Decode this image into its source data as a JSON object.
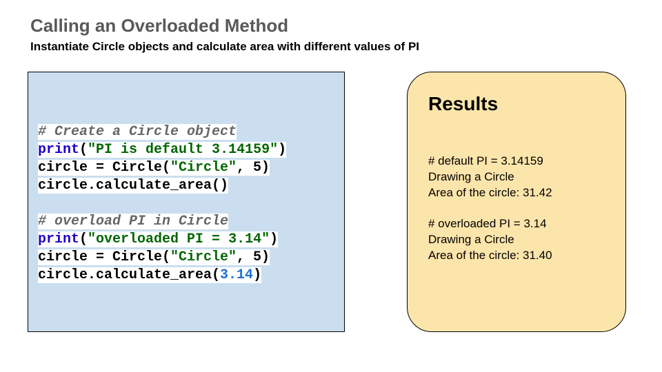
{
  "header": {
    "title": "Calling an Overloaded Method",
    "subtitle": "Instantiate Circle objects and calculate area with different values of PI"
  },
  "code": {
    "lines": [
      {
        "type": "code",
        "tokens": [
          {
            "cls": "comment",
            "text": "# Create a Circle object"
          }
        ]
      },
      {
        "type": "code",
        "tokens": [
          {
            "cls": "keyword",
            "text": "print"
          },
          {
            "cls": "plain",
            "text": "("
          },
          {
            "cls": "string",
            "text": "\"PI is default 3.14159\""
          },
          {
            "cls": "plain",
            "text": ")"
          }
        ]
      },
      {
        "type": "code",
        "tokens": [
          {
            "cls": "plain",
            "text": "circle = Circle("
          },
          {
            "cls": "string",
            "text": "\"Circle\""
          },
          {
            "cls": "plain",
            "text": ", 5)"
          }
        ]
      },
      {
        "type": "code",
        "tokens": [
          {
            "cls": "plain",
            "text": "circle.calculate_area()"
          }
        ]
      },
      {
        "type": "blank"
      },
      {
        "type": "code",
        "tokens": [
          {
            "cls": "comment",
            "text": "# overload PI in Circle"
          }
        ]
      },
      {
        "type": "code",
        "tokens": [
          {
            "cls": "keyword",
            "text": "print"
          },
          {
            "cls": "plain",
            "text": "("
          },
          {
            "cls": "string",
            "text": "\"overloaded PI = 3.14\""
          },
          {
            "cls": "plain",
            "text": ")"
          }
        ]
      },
      {
        "type": "code",
        "tokens": [
          {
            "cls": "plain",
            "text": "circle = Circle("
          },
          {
            "cls": "string",
            "text": "\"Circle\""
          },
          {
            "cls": "plain",
            "text": ", 5)"
          }
        ]
      },
      {
        "type": "code",
        "tokens": [
          {
            "cls": "plain",
            "text": "circle.calculate_area("
          },
          {
            "cls": "number",
            "text": "3.14"
          },
          {
            "cls": "plain",
            "text": ")"
          }
        ]
      }
    ]
  },
  "results": {
    "title": "Results",
    "lines": [
      {
        "type": "text",
        "text": "# default PI = 3.14159"
      },
      {
        "type": "text",
        "text": "Drawing a Circle"
      },
      {
        "type": "text",
        "text": "Area of the circle: 31.42"
      },
      {
        "type": "blank"
      },
      {
        "type": "text",
        "text": "# overloaded PI = 3.14"
      },
      {
        "type": "text",
        "text": "Drawing a Circle"
      },
      {
        "type": "text",
        "text": "Area of the circle: 31.40"
      }
    ]
  }
}
